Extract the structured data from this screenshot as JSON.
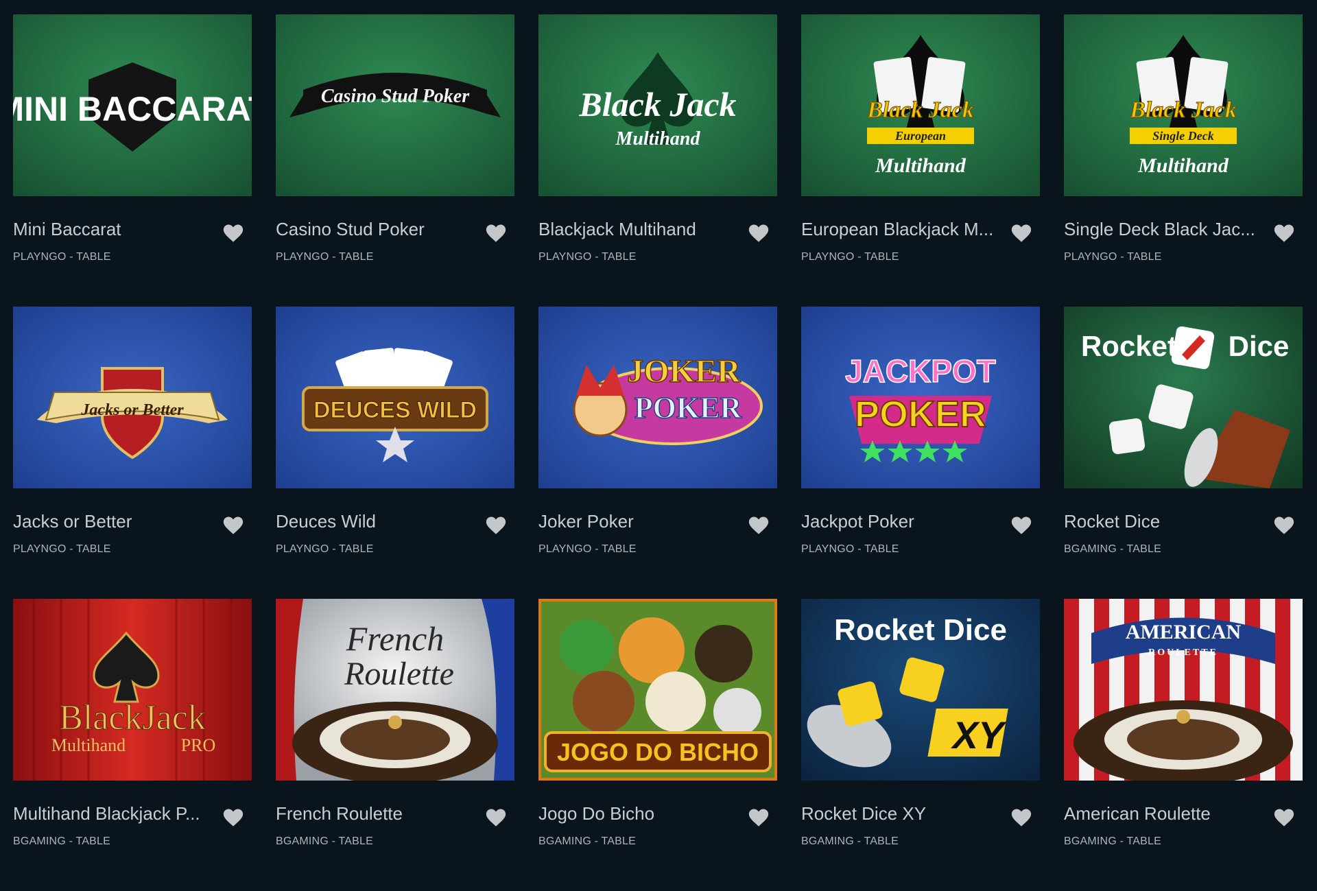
{
  "colors": {
    "background": "#0a141c",
    "title_text": "#c9ced3",
    "subtitle_text": "#aeb4ba",
    "heart_icon": "#c4c7ca",
    "felt_green": "#1f6a3e",
    "felt_blue": "#2247a0",
    "curtain_red": "#c0241e"
  },
  "games": [
    {
      "title": "Mini Baccarat",
      "provider_line": "PLAYNGO - TABLE",
      "thumb_text": "MINI BACCARAT",
      "thumb_sub": "",
      "fav_icon": "heart-icon"
    },
    {
      "title": "Casino Stud Poker",
      "provider_line": "PLAYNGO - TABLE",
      "thumb_text": "Casino Stud Poker",
      "thumb_sub": "",
      "fav_icon": "heart-icon"
    },
    {
      "title": "Blackjack Multihand",
      "provider_line": "PLAYNGO - TABLE",
      "thumb_text": "Black Jack",
      "thumb_sub": "Multihand",
      "fav_icon": "heart-icon"
    },
    {
      "title": "European Blackjack M...",
      "provider_line": "PLAYNGO - TABLE",
      "thumb_text": "Black Jack",
      "thumb_sub": "European",
      "thumb_sub2": "Multihand",
      "fav_icon": "heart-icon"
    },
    {
      "title": "Single Deck Black Jac...",
      "provider_line": "PLAYNGO - TABLE",
      "thumb_text": "Black Jack",
      "thumb_sub": "Single Deck",
      "thumb_sub2": "Multihand",
      "fav_icon": "heart-icon"
    },
    {
      "title": "Jacks or Better",
      "provider_line": "PLAYNGO - TABLE",
      "thumb_text": "Jacks or Better",
      "thumb_sub": "",
      "fav_icon": "heart-icon"
    },
    {
      "title": "Deuces Wild",
      "provider_line": "PLAYNGO - TABLE",
      "thumb_text": "DEUCES WILD",
      "thumb_sub": "",
      "fav_icon": "heart-icon"
    },
    {
      "title": "Joker Poker",
      "provider_line": "PLAYNGO - TABLE",
      "thumb_text": "JOKER",
      "thumb_sub": "POKER",
      "fav_icon": "heart-icon"
    },
    {
      "title": "Jackpot Poker",
      "provider_line": "PLAYNGO - TABLE",
      "thumb_text": "JACKPOT",
      "thumb_sub": "POKER",
      "fav_icon": "heart-icon"
    },
    {
      "title": "Rocket Dice",
      "provider_line": "BGAMING - TABLE",
      "thumb_text": "Rocket",
      "thumb_sub": "Dice",
      "fav_icon": "heart-icon"
    },
    {
      "title": "Multihand Blackjack P...",
      "provider_line": "BGAMING - TABLE",
      "thumb_text": "BlackJack",
      "thumb_sub": "Multihand",
      "thumb_sub2": "PRO",
      "fav_icon": "heart-icon"
    },
    {
      "title": "French Roulette",
      "provider_line": "BGAMING - TABLE",
      "thumb_text": "French",
      "thumb_sub": "Roulette",
      "fav_icon": "heart-icon"
    },
    {
      "title": "Jogo Do Bicho",
      "provider_line": "BGAMING - TABLE",
      "thumb_text": "JOGO DO BICHO",
      "thumb_sub": "",
      "fav_icon": "heart-icon"
    },
    {
      "title": "Rocket Dice XY",
      "provider_line": "BGAMING - TABLE",
      "thumb_text": "Rocket Dice",
      "thumb_sub": "XY",
      "fav_icon": "heart-icon"
    },
    {
      "title": "American Roulette",
      "provider_line": "BGAMING - TABLE",
      "thumb_text": "AMERICAN",
      "thumb_sub": "ROULETTE",
      "fav_icon": "heart-icon"
    }
  ]
}
